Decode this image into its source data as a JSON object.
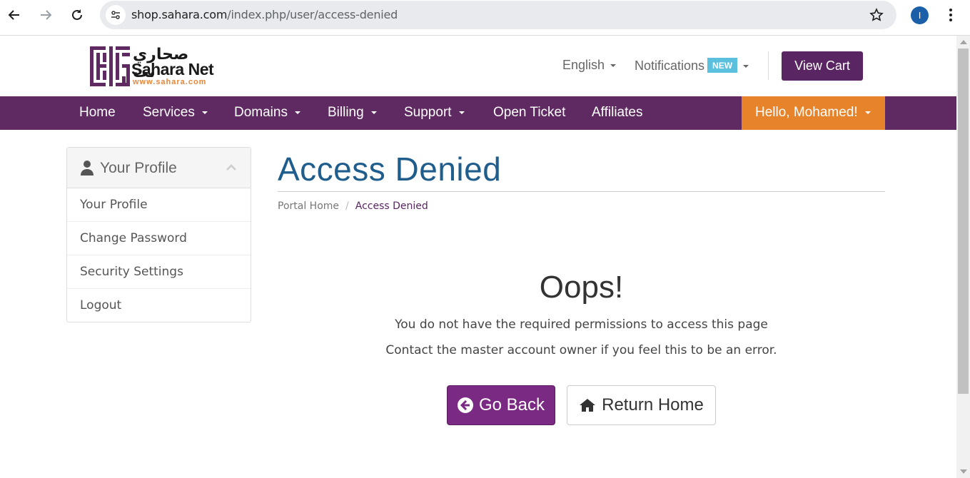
{
  "browser": {
    "url_host": "shop.sahara.com",
    "url_path": "/index.php/user/access-denied",
    "profile_initial": "I"
  },
  "header": {
    "logo": {
      "arabic": "صحاري نت",
      "brand": "Sahara Net",
      "www": "www.sahara.com"
    },
    "language": "English",
    "notifications": "Notifications",
    "notifications_badge": "NEW",
    "view_cart": "View Cart"
  },
  "navbar": {
    "items": [
      {
        "label": "Home",
        "dropdown": false
      },
      {
        "label": "Services",
        "dropdown": true
      },
      {
        "label": "Domains",
        "dropdown": true
      },
      {
        "label": "Billing",
        "dropdown": true
      },
      {
        "label": "Support",
        "dropdown": true
      },
      {
        "label": "Open Ticket",
        "dropdown": false
      },
      {
        "label": "Affiliates",
        "dropdown": false
      }
    ],
    "user": "Hello, Mohamed!"
  },
  "sidebar": {
    "title": "Your Profile",
    "items": [
      {
        "label": "Your Profile"
      },
      {
        "label": "Change Password"
      },
      {
        "label": "Security Settings"
      },
      {
        "label": "Logout"
      }
    ]
  },
  "main": {
    "title": "Access Denied",
    "breadcrumb": {
      "home": "Portal Home",
      "separator": "/",
      "current": "Access Denied"
    },
    "heading": "Oops!",
    "message": "You do not have the required permissions to access this page",
    "hint": "Contact the master account owner if you feel this to be an error.",
    "go_back": "Go Back",
    "return_home": "Return Home"
  },
  "colors": {
    "brand_purple": "#5f2a62",
    "accent_orange": "#e6832b",
    "title_blue": "#1f5d8c",
    "badge_blue": "#5bc0de"
  }
}
